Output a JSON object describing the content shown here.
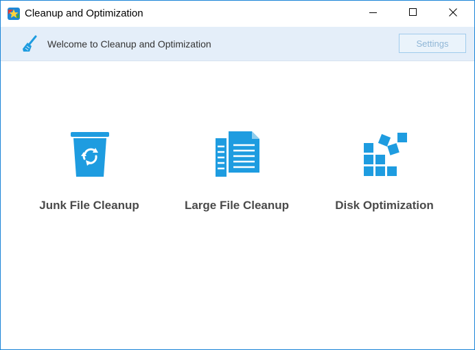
{
  "window": {
    "title": "Cleanup and Optimization",
    "app_icon": "star-badge-icon",
    "controls": {
      "minimize": "minimize-icon",
      "maximize": "maximize-icon",
      "close": "close-icon"
    }
  },
  "header": {
    "icon": "broom-icon",
    "welcome": "Welcome to Cleanup and Optimization",
    "settings_label": "Settings"
  },
  "tools": [
    {
      "label": "Junk File Cleanup",
      "icon": "recycle-bin-icon"
    },
    {
      "label": "Large File Cleanup",
      "icon": "documents-icon"
    },
    {
      "label": "Disk Optimization",
      "icon": "defrag-blocks-icon"
    }
  ],
  "colors": {
    "accent": "#1e9ce0",
    "window_border": "#1883d7",
    "header_bg": "#e4eef9",
    "settings_border": "#9fcbec",
    "settings_text": "#8fb6d6",
    "label_text": "#4a4a4a"
  }
}
